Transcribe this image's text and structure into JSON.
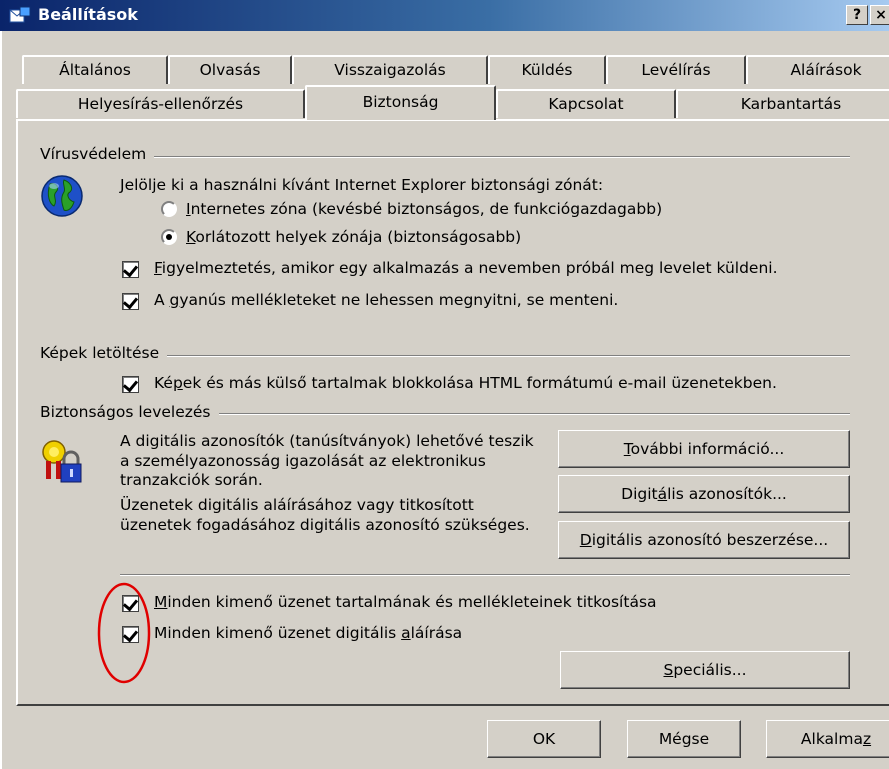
{
  "window": {
    "title": "Beállítások",
    "help_button": "?",
    "close_button": "×"
  },
  "tabs": {
    "row1": [
      "Általános",
      "Olvasás",
      "Visszaigazolás",
      "Küldés",
      "Levélírás",
      "Aláírások"
    ],
    "row2": [
      "Helyesírás-ellenőrzés",
      "Biztonság",
      "Kapcsolat",
      "Karbantartás"
    ],
    "selected": "Biztonság"
  },
  "virus": {
    "group_label": "Vírusvédelem",
    "zone_prompt": "Jelölje ki a használni kívánt Internet Explorer biztonsági zónát:",
    "radio_internet": {
      "pre": "",
      "ul": "I",
      "post": "nternetes zóna (kevésbé biztonságos, de funkciógazdagabb)",
      "checked": false
    },
    "radio_restricted": {
      "pre": "",
      "ul": "K",
      "post": "orlátozott helyek zónája (biztonságosabb)",
      "checked": true
    },
    "warn_checkbox": {
      "pre": "",
      "ul": "F",
      "post": "igyelmeztetés, amikor egy alkalmazás a nevemben próbál meg levelet küldeni.",
      "checked": true
    },
    "attach_checkbox": {
      "pre": "A ",
      "ul": "g",
      "post": "yanús mellékleteket ne lehessen megnyitni, se menteni.",
      "checked": true
    }
  },
  "images": {
    "group_label": "Képek letöltése",
    "block_checkbox": {
      "pre": "Ké",
      "ul": "p",
      "post": "ek és más külső tartalmak blokkolása HTML formátumú e-mail üzenetekben.",
      "checked": true
    }
  },
  "secure": {
    "group_label": "Biztonságos levelezés",
    "info_line1": "A digitális azonosítók (tanúsítványok) lehetővé teszik",
    "info_line2": "a személyazonosság igazolását az elektronikus",
    "info_line3": "tranzakciók során.",
    "info2_line1": "Üzenetek digitális aláírásához vagy titkosított",
    "info2_line2": "üzenetek fogadásához digitális azonosító szükséges.",
    "btn_more": {
      "pre": "",
      "ul": "T",
      "post": "ovábbi információ..."
    },
    "btn_ids": {
      "pre": "Digit",
      "ul": "á",
      "post": "lis azonosítók..."
    },
    "btn_get": {
      "pre": "",
      "ul": "D",
      "post": "igitális azonosító beszerzése..."
    },
    "encrypt_checkbox": {
      "pre": "",
      "ul": "M",
      "post": "inden kimenő üzenet tartalmának és mellékleteinek titkosítása",
      "checked": true
    },
    "sign_checkbox": {
      "pre": "Minden kimenő üzenet digitális ",
      "ul": "a",
      "post": "láírása",
      "checked": true
    },
    "btn_advanced": {
      "pre": "",
      "ul": "S",
      "post": "peciális..."
    }
  },
  "footer": {
    "ok": "OK",
    "cancel": "Mégse",
    "apply": {
      "pre": "Alkalma",
      "ul": "z",
      "post": ""
    }
  },
  "colors": {
    "titlebar_start": "#0a246a",
    "titlebar_end": "#a6caf0",
    "face": "#d4d0c8",
    "annotation": "#e00000"
  }
}
